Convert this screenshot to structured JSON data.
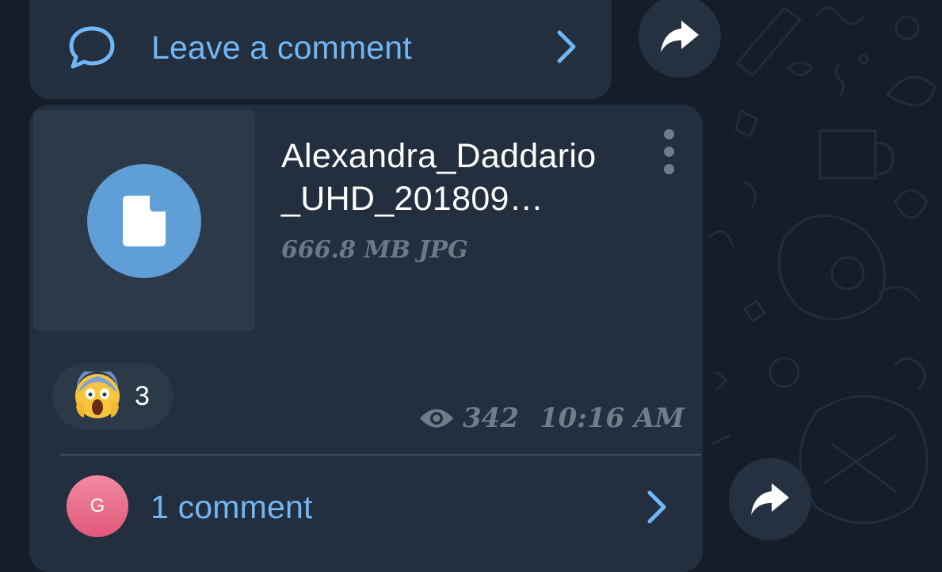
{
  "top_bubble": {
    "comment_label": "Leave a comment",
    "icons": {
      "comment": "speech-bubble-icon",
      "chevron": "chevron-right-icon",
      "forward": "share-arrow-icon"
    }
  },
  "file_message": {
    "file_name": "Alexandra_Daddario_UHD_201809...",
    "file_name_line1": "Alexandra_Daddario",
    "file_name_line2": "_UHD_201809…",
    "file_meta": "666.8 MB JPG",
    "file_icon": "document-icon",
    "menu_icon": "more-vertical-icon",
    "reaction": {
      "emoji": "face-screaming-in-fear",
      "count": "3"
    },
    "views": "342",
    "time": "10:16 AM",
    "comments": {
      "avatar_letter": "G",
      "label": "1 comment"
    }
  },
  "colors": {
    "background": "#151d2b",
    "bubble": "#232f3f",
    "accent": "#71b7f5",
    "file_icon_circle": "#5f9ed6",
    "muted_text": "#6c7a88",
    "avatar": "#e9718c"
  }
}
